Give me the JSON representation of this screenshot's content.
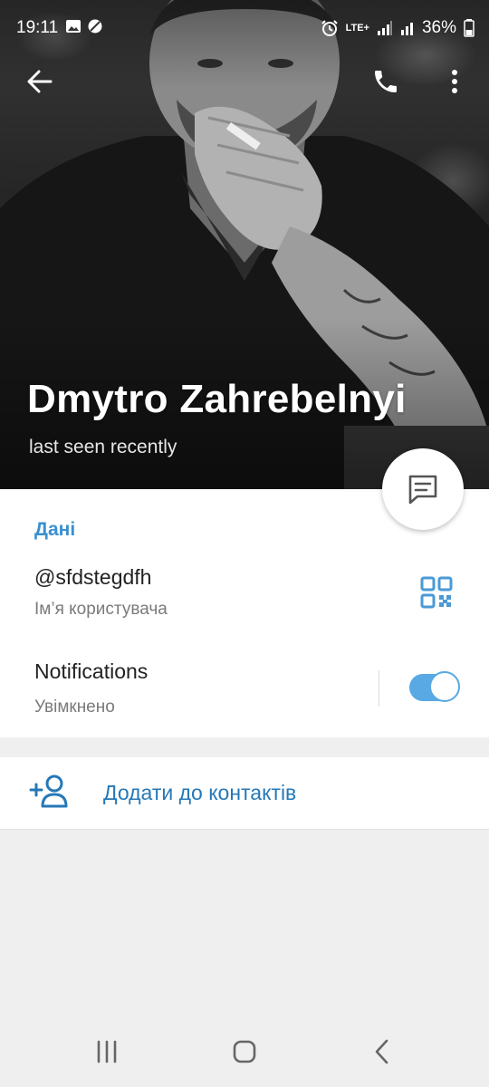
{
  "status_bar": {
    "time": "19:11",
    "network": "LTE+",
    "battery": "36%"
  },
  "profile": {
    "name": "Dmytro Zahrebelnyi",
    "last_seen": "last seen recently"
  },
  "info": {
    "section_title": "Дані",
    "username": "@sfdstegdfh",
    "username_label": "Ім’я користувача",
    "notifications_title": "Notifications",
    "notifications_state": "Увімкнено",
    "notifications_enabled": true
  },
  "actions": {
    "add_contact_label": "Додати до контактів"
  },
  "colors": {
    "accent": "#3a8fd0",
    "link": "#2678b7",
    "toggle": "#58a9e4"
  },
  "icons": [
    "back-arrow-icon",
    "phone-icon",
    "more-vertical-icon",
    "message-icon",
    "qr-code-icon",
    "add-person-icon"
  ]
}
